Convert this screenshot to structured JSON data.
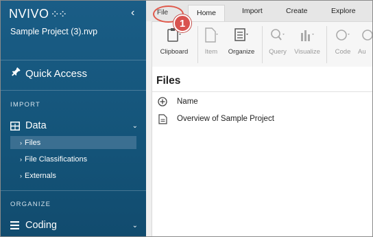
{
  "sidebar": {
    "logo": "NVIVO",
    "logo_mark": "⁘⁘",
    "project_name": "Sample Project (3).nvp",
    "quick_access": "Quick Access",
    "sections": {
      "import": "IMPORT",
      "organize": "ORGANIZE"
    },
    "data_group": {
      "label": "Data",
      "items": [
        {
          "label": "Files",
          "active": true
        },
        {
          "label": "File Classifications",
          "active": false
        },
        {
          "label": "Externals",
          "active": false
        }
      ]
    },
    "coding_group": {
      "label": "Coding"
    }
  },
  "ribbon": {
    "tabs": [
      "File",
      "Home",
      "Import",
      "Create",
      "Explore"
    ],
    "active_tab": "Home",
    "buttons": [
      {
        "label": "Clipboard",
        "icon": "clipboard-icon",
        "enabled": true
      },
      {
        "label": "Item",
        "icon": "document-icon",
        "enabled": false
      },
      {
        "label": "Organize",
        "icon": "organize-icon",
        "enabled": true
      },
      {
        "label": "Query",
        "icon": "query-icon",
        "enabled": false
      },
      {
        "label": "Visualize",
        "icon": "chart-icon",
        "enabled": false
      },
      {
        "label": "Code",
        "icon": "code-icon",
        "enabled": false
      },
      {
        "label": "Au",
        "icon": "auto-code-icon",
        "enabled": false
      }
    ]
  },
  "files": {
    "title": "Files",
    "column_header": "Name",
    "rows": [
      {
        "name": "Overview of Sample Project"
      }
    ]
  },
  "annotation": {
    "badge": "1",
    "color": "#d9534f"
  },
  "colors": {
    "sidebar_bg": "#155a82",
    "active_item": "#3b6f91"
  }
}
